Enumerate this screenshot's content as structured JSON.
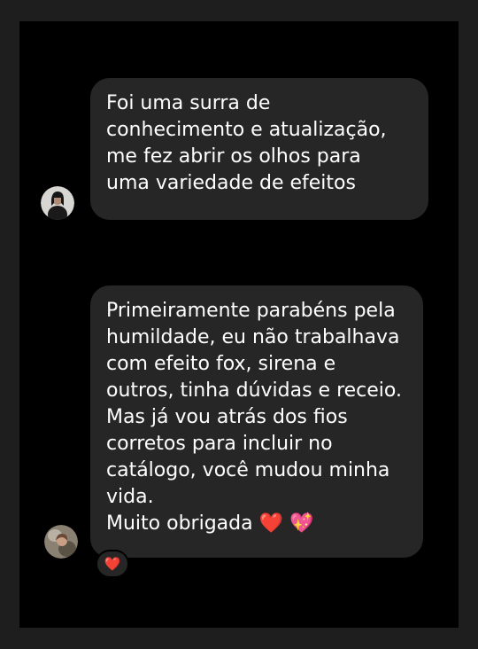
{
  "messages": [
    {
      "lines": [
        "Foi uma surra de",
        "conhecimento e atualização,",
        "me fez abrir os olhos para",
        "uma variedade de efeitos"
      ]
    },
    {
      "lines": [
        "Primeiramente parabéns pela",
        "humildade, eu não trabalhava",
        "com efeito fox, sirena e",
        "outros, tinha dúvidas e receio.",
        "Mas já vou atrás dos fios",
        "corretos para incluir no",
        "catálogo, você mudou minha",
        "vida."
      ],
      "closing_text": "Muito obrigada",
      "closing_emojis": [
        "❤️",
        "💖"
      ],
      "reaction": "❤️"
    }
  ],
  "colors": {
    "bubble": "#262626",
    "background": "#000000",
    "text": "#ffffff",
    "reaction_heart": "#ff2d3a"
  }
}
